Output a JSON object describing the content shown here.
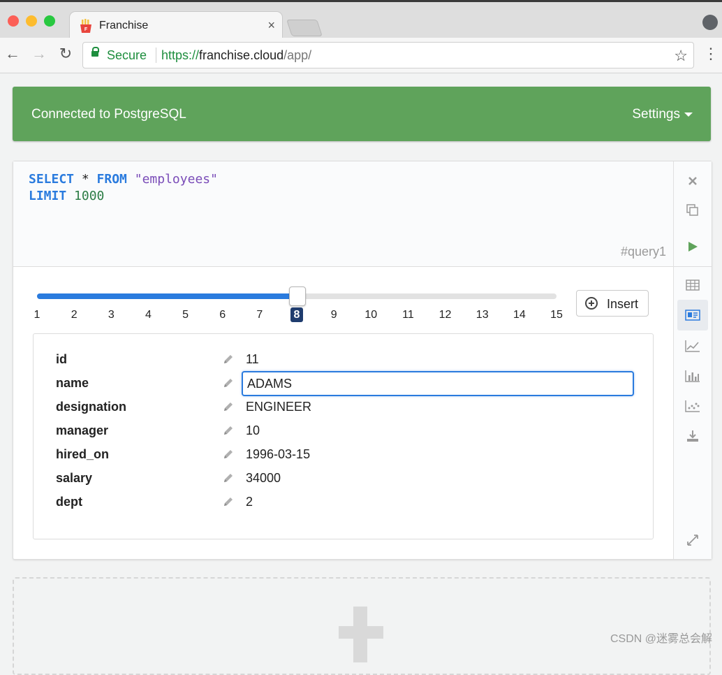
{
  "browser": {
    "tab_title": "Franchise",
    "tab_close": "×",
    "secure_label": "Secure",
    "url_scheme": "https://",
    "url_host": "franchise.cloud",
    "url_path": "/app/",
    "back_glyph": "←",
    "forward_glyph": "→",
    "reload_glyph": "↻",
    "star_glyph": "☆",
    "menu_glyph": "⋮"
  },
  "connection": {
    "status": "Connected to PostgreSQL",
    "settings_label": "Settings"
  },
  "query": {
    "line1": {
      "kw1": "SELECT",
      "op": " * ",
      "kw2": "FROM",
      "str": " \"employees\""
    },
    "line2": {
      "kw": "LIMIT",
      "num": " 1000"
    },
    "id": "#query1"
  },
  "sidebar_icons": [
    "close-icon",
    "copy-icon",
    "run-icon",
    "table-icon",
    "card-icon",
    "line-chart-icon",
    "bar-chart-icon",
    "scatter-chart-icon",
    "download-icon"
  ],
  "slider": {
    "min": 1,
    "max": 15,
    "value": 8,
    "ticks": [
      "1",
      "2",
      "3",
      "4",
      "5",
      "6",
      "7",
      "8",
      "9",
      "10",
      "11",
      "12",
      "13",
      "14",
      "15"
    ],
    "accent": "#2a7bde"
  },
  "insert_button": {
    "label": "Insert"
  },
  "record": {
    "fields": [
      {
        "name": "id",
        "value": "11"
      },
      {
        "name": "name",
        "value": "ADAMS"
      },
      {
        "name": "designation",
        "value": "ENGINEER"
      },
      {
        "name": "manager",
        "value": "10"
      },
      {
        "name": "hired_on",
        "value": "1996-03-15"
      },
      {
        "name": "salary",
        "value": "34000"
      },
      {
        "name": "dept",
        "value": "2"
      }
    ],
    "editing_field": "name"
  },
  "colors": {
    "connected_bar": "#5fa35b",
    "keyword": "#2a7bde",
    "string": "#7a4cb8",
    "number": "#2d7d46"
  },
  "watermark": "CSDN @迷雾总会解"
}
